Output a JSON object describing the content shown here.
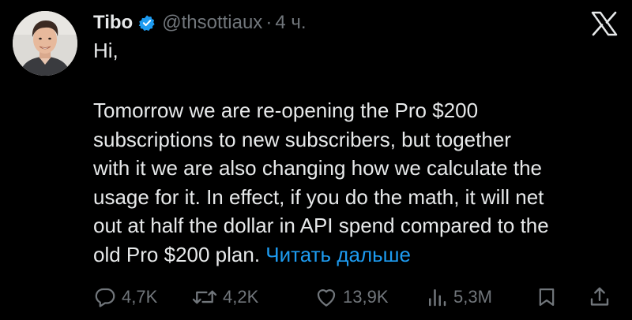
{
  "author": {
    "name": "Tibo",
    "handle": "@thsottiaux",
    "separator": "·",
    "time": "4 ч."
  },
  "tweet": {
    "greeting": "Hi,",
    "lines": [
      "Tomorrow we are re-opening the Pro $200",
      "subscriptions to new subscribers, but together",
      "with it we are also changing how we calculate the",
      "usage for it. In effect, if you do the math, it will net",
      "out at half the dollar in API spend compared to the",
      "old Pro $200 plan."
    ],
    "read_more": "Читать дальше"
  },
  "actions": {
    "replies": "4,7K",
    "reposts": "4,2K",
    "likes": "13,9K",
    "views": "5,3M"
  },
  "icons": {
    "logo": "x-logo-icon",
    "verified": "verified-badge-icon",
    "reply": "reply-icon",
    "repost": "repost-icon",
    "like": "heart-icon",
    "views": "views-icon",
    "bookmark": "bookmark-icon",
    "share": "share-icon"
  },
  "colors": {
    "background": "#000000",
    "text": "#e7e9ea",
    "muted": "#71767b",
    "link": "#1d9bf0"
  }
}
